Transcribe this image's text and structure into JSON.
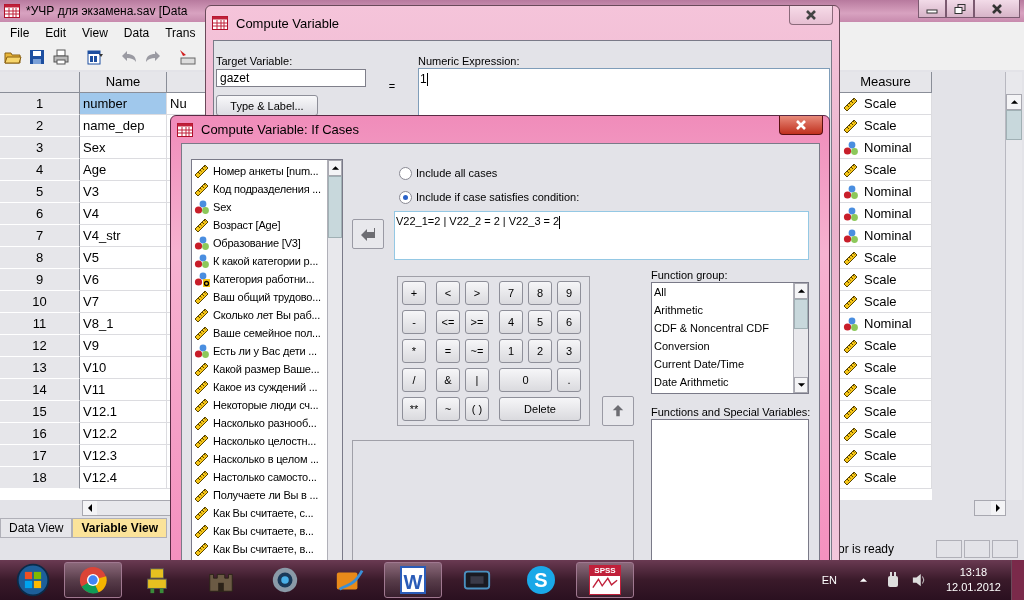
{
  "main_window": {
    "title": "*УЧР для экзамена.sav [Data",
    "menu": [
      "File",
      "Edit",
      "View",
      "Data",
      "Trans"
    ],
    "columns": {
      "name": "Name",
      "measure": "Measure"
    },
    "rows": [
      {
        "number": "1",
        "name": "number",
        "column_3": "Nu",
        "selected": true,
        "measure": {
          "label": "Scale",
          "kind": "scale"
        }
      },
      {
        "number": "2",
        "name": "name_dep",
        "selected": false,
        "measure": {
          "label": "Scale",
          "kind": "scale"
        }
      },
      {
        "number": "3",
        "name": "Sex",
        "selected": false,
        "measure": {
          "label": "Nominal",
          "kind": "nominal"
        }
      },
      {
        "number": "4",
        "name": "Age",
        "selected": false,
        "measure": {
          "label": "Scale",
          "kind": "scale"
        }
      },
      {
        "number": "5",
        "name": "V3",
        "selected": false,
        "measure": {
          "label": "Nominal",
          "kind": "nominal"
        }
      },
      {
        "number": "6",
        "name": "V4",
        "selected": false,
        "measure": {
          "label": "Nominal",
          "kind": "nominal"
        }
      },
      {
        "number": "7",
        "name": "V4_str",
        "selected": false,
        "measure": {
          "label": "Nominal",
          "kind": "nominal"
        }
      },
      {
        "number": "8",
        "name": "V5",
        "selected": false,
        "measure": {
          "label": "Scale",
          "kind": "scale"
        }
      },
      {
        "number": "9",
        "name": "V6",
        "selected": false,
        "measure": {
          "label": "Scale",
          "kind": "scale"
        }
      },
      {
        "number": "10",
        "name": "V7",
        "selected": false,
        "measure": {
          "label": "Scale",
          "kind": "scale"
        }
      },
      {
        "number": "11",
        "name": "V8_1",
        "selected": false,
        "measure": {
          "label": "Nominal",
          "kind": "nominal"
        }
      },
      {
        "number": "12",
        "name": "V9",
        "selected": false,
        "measure": {
          "label": "Scale",
          "kind": "scale"
        }
      },
      {
        "number": "13",
        "name": "V10",
        "selected": false,
        "measure": {
          "label": "Scale",
          "kind": "scale"
        }
      },
      {
        "number": "14",
        "name": "V11",
        "selected": false,
        "measure": {
          "label": "Scale",
          "kind": "scale"
        }
      },
      {
        "number": "15",
        "name": "V12.1",
        "selected": false,
        "measure": {
          "label": "Scale",
          "kind": "scale"
        }
      },
      {
        "number": "16",
        "name": "V12.2",
        "selected": false,
        "measure": {
          "label": "Scale",
          "kind": "scale"
        }
      },
      {
        "number": "17",
        "name": "V12.3",
        "selected": false,
        "measure": {
          "label": "Scale",
          "kind": "scale"
        }
      },
      {
        "number": "18",
        "name": "V12.4",
        "selected": false,
        "measure": {
          "label": "Scale",
          "kind": "scale"
        }
      }
    ],
    "tabs": [
      {
        "label": "Data View",
        "selected": false
      },
      {
        "label": "Variable View",
        "selected": true
      }
    ],
    "status": "or is ready"
  },
  "compute_dialog": {
    "title": "Compute Variable",
    "target_label": "Target Variable:",
    "target_value": "gazet",
    "equals": "=",
    "type_label_button": "Type & Label...",
    "expression_label": "Numeric Expression:",
    "expression_value": "1"
  },
  "if_dialog": {
    "title": "Compute Variable: If Cases",
    "variables": [
      {
        "label": "Номер анкеты [num...",
        "kind": "scale"
      },
      {
        "label": "Код подразделения ...",
        "kind": "scale"
      },
      {
        "label": "Sex",
        "kind": "nominal"
      },
      {
        "label": "Возраст [Age]",
        "kind": "scale"
      },
      {
        "label": "Образование [V3]",
        "kind": "nominal"
      },
      {
        "label": "К какой категории р...",
        "kind": "nominal"
      },
      {
        "label": "Категория работни...",
        "kind": "string"
      },
      {
        "label": "Ваш общий трудово...",
        "kind": "scale"
      },
      {
        "label": "Сколько лет Вы раб...",
        "kind": "scale"
      },
      {
        "label": "Ваше семейное пол...",
        "kind": "scale"
      },
      {
        "label": "Есть ли у Вас дети ...",
        "kind": "nominal"
      },
      {
        "label": "Какой размер Ваше...",
        "kind": "scale"
      },
      {
        "label": "Какое из суждений ...",
        "kind": "scale"
      },
      {
        "label": "Некоторые люди сч...",
        "kind": "scale"
      },
      {
        "label": "Насколько разнооб...",
        "kind": "scale"
      },
      {
        "label": "Насколько целостн...",
        "kind": "scale"
      },
      {
        "label": "Насколько в целом ...",
        "kind": "scale"
      },
      {
        "label": "Настолько самосто...",
        "kind": "scale"
      },
      {
        "label": "Получаете ли Вы в ...",
        "kind": "scale"
      },
      {
        "label": "Как Вы считаете, с...",
        "kind": "scale"
      },
      {
        "label": "Как Вы считаете, в...",
        "kind": "scale"
      },
      {
        "label": "Как Вы считаете, в...",
        "kind": "scale"
      }
    ],
    "options": [
      {
        "label": "Include all cases",
        "selected": false
      },
      {
        "label": "Include if case satisfies condition:",
        "selected": true
      }
    ],
    "condition": "V22_1=2 | V22_2 = 2 | V22_3 = 2",
    "keypad": {
      "operators": [
        "+",
        "-",
        "*",
        "/",
        "**"
      ],
      "comparisons": [
        "<",
        ">",
        "<=",
        ">=",
        "=",
        "~=",
        "&",
        "|",
        "~",
        "( )"
      ],
      "digits": [
        {
          "label": "7",
          "kind": "key"
        },
        {
          "label": "8",
          "kind": "key"
        },
        {
          "label": "9",
          "kind": "key"
        },
        {
          "label": "4",
          "kind": "key"
        },
        {
          "label": "5",
          "kind": "key"
        },
        {
          "label": "6",
          "kind": "key"
        },
        {
          "label": "1",
          "kind": "key"
        },
        {
          "label": "2",
          "kind": "key"
        },
        {
          "label": "3",
          "kind": "key"
        },
        {
          "label": "0",
          "kind": "wide"
        },
        {
          "label": ".",
          "kind": "key"
        },
        {
          "label": "Delete",
          "kind": "wider"
        }
      ]
    },
    "function_group_label": "Function group:",
    "function_groups": [
      "All",
      "Arithmetic",
      "CDF & Noncentral CDF",
      "Conversion",
      "Current Date/Time",
      "Date Arithmetic"
    ],
    "functions_label": "Functions and Special Variables:"
  },
  "taskbar": {
    "apps": [
      {
        "kind": "start"
      },
      {
        "kind": "browser",
        "running": true
      },
      {
        "kind": "robot",
        "running": false
      },
      {
        "kind": "castle",
        "running": false
      },
      {
        "kind": "disc",
        "running": false
      },
      {
        "kind": "film",
        "running": false
      },
      {
        "kind": "document",
        "label": "W",
        "running": true
      },
      {
        "kind": "monitor",
        "running": false
      },
      {
        "kind": "chat",
        "label": "S",
        "running": false
      },
      {
        "kind": "chart",
        "label": "SPSS",
        "running": true
      }
    ],
    "language": "EN",
    "time": "13:18",
    "date": "12.01.2012"
  }
}
